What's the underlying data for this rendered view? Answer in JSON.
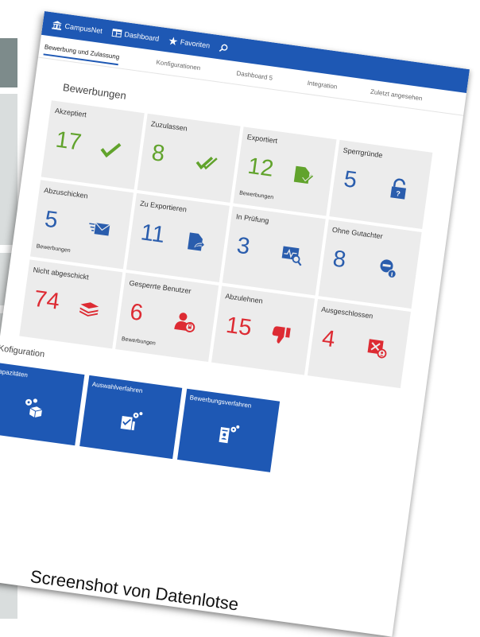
{
  "nav": {
    "campus": "CampusNet",
    "dashboard": "Dashboard",
    "favorites": "Favoriten"
  },
  "tabs": [
    {
      "label": "Bewerbung und Zulassung",
      "active": true
    },
    {
      "label": "Konfigurationen"
    },
    {
      "label": "Dashboard 5"
    },
    {
      "label": "Integration"
    },
    {
      "label": "Zuletzt angesehen"
    }
  ],
  "bewerbungen": {
    "title": "Bewerbungen",
    "tiles": [
      {
        "label": "Akzeptiert",
        "value": "17",
        "sub": "",
        "color": "#61a32c",
        "icon": "check-icon"
      },
      {
        "label": "Zuzulassen",
        "value": "8",
        "sub": "",
        "color": "#61a32c",
        "icon": "double-check-icon"
      },
      {
        "label": "Exportiert",
        "value": "12",
        "sub": "Bewerbungen",
        "color": "#61a32c",
        "icon": "document-export-icon"
      },
      {
        "label": "Sperrgründe",
        "value": "5",
        "sub": "",
        "color": "#2a5dad",
        "icon": "lock-icon"
      },
      {
        "label": "Abzuschicken",
        "value": "5",
        "sub": "Bewerbungen",
        "color": "#2a5dad",
        "icon": "mail-send-icon"
      },
      {
        "label": "Zu Exportieren",
        "value": "11",
        "sub": "",
        "color": "#2a5dad",
        "icon": "document-share-icon"
      },
      {
        "label": "In Prüfung",
        "value": "3",
        "sub": "",
        "color": "#2a5dad",
        "icon": "monitor-search-icon"
      },
      {
        "label": "Ohne Gutachter",
        "value": "8",
        "sub": "",
        "color": "#2a5dad",
        "icon": "reviewer-info-icon"
      },
      {
        "label": "Nicht abgeschickt",
        "value": "74",
        "sub": "",
        "color": "#dd2b33",
        "icon": "stack-icon"
      },
      {
        "label": "Gesperrte Benutzer",
        "value": "6",
        "sub": "Bewerbungen",
        "color": "#dd2b33",
        "icon": "user-blocked-icon"
      },
      {
        "label": "Abzulehnen",
        "value": "15",
        "sub": "",
        "color": "#dd2b33",
        "icon": "thumbs-down-icon"
      },
      {
        "label": "Ausgeschlossen",
        "value": "4",
        "sub": "",
        "color": "#dd2b33",
        "icon": "excluded-icon"
      }
    ]
  },
  "konfiguration": {
    "title": "Kofiguration",
    "tiles": [
      {
        "label": "Kapazitäten",
        "icon": "gear-box-icon"
      },
      {
        "label": "Auswahlverfahren",
        "icon": "gear-checklist-icon"
      },
      {
        "label": "Bewerbungsverfahren",
        "icon": "gear-document-icon"
      }
    ]
  },
  "caption": "Screenshot von Datenlotse"
}
